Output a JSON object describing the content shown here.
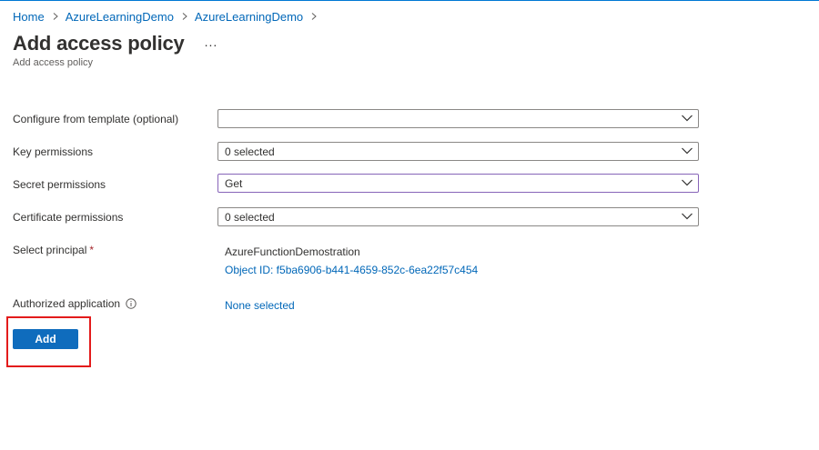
{
  "breadcrumb": {
    "items": [
      "Home",
      "AzureLearningDemo",
      "AzureLearningDemo"
    ]
  },
  "header": {
    "title": "Add access policy",
    "more": "...",
    "subtitle": "Add access policy"
  },
  "form": {
    "template": {
      "label": "Configure from template (optional)",
      "value": ""
    },
    "key_permissions": {
      "label": "Key permissions",
      "value": "0 selected"
    },
    "secret_permissions": {
      "label": "Secret permissions",
      "value": "Get"
    },
    "certificate_permissions": {
      "label": "Certificate permissions",
      "value": "0 selected"
    },
    "principal": {
      "label": "Select principal",
      "required_marker": "*",
      "name": "AzureFunctionDemostration",
      "object_id": "Object ID: f5ba6906-b441-4659-852c-6ea22f57c454"
    },
    "authorized_app": {
      "label": "Authorized application",
      "value": "None selected"
    }
  },
  "actions": {
    "add_label": "Add"
  },
  "colors": {
    "accent": "#0f6cbd",
    "link": "#0067b8",
    "focus_border": "#8764b8",
    "highlight": "#e31b1b"
  },
  "icons": {
    "breadcrumb_separator": "chevron-right-icon",
    "dropdown": "chevron-down-icon",
    "info": "info-icon"
  }
}
